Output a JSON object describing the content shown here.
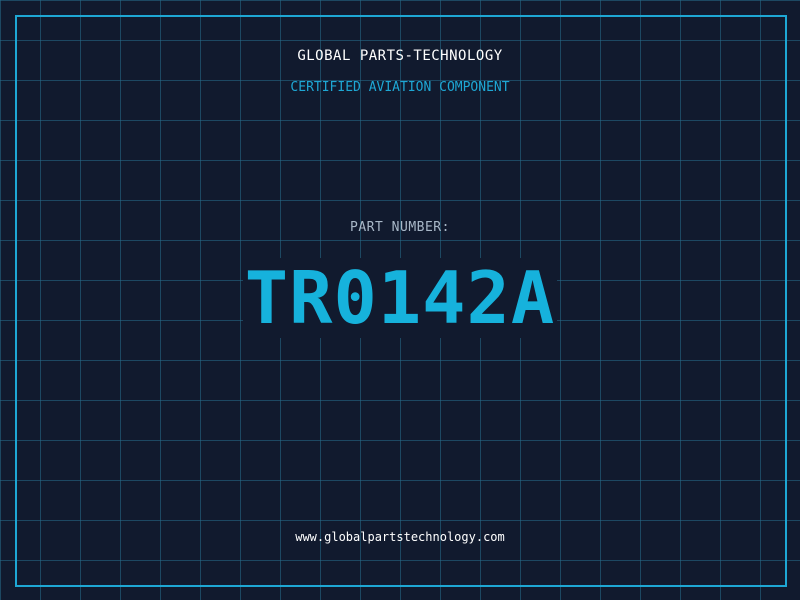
{
  "header": {
    "company": "GLOBAL PARTS-TECHNOLOGY",
    "subtitle": "CERTIFIED AVIATION COMPONENT"
  },
  "main": {
    "label": "PART NUMBER:",
    "part_number": "TR0142A"
  },
  "footer": {
    "website": "www.globalpartstechnology.com"
  },
  "colors": {
    "background": "#111a2e",
    "accent": "#1ea7d4",
    "part_number": "#16b2dc",
    "label": "#a9b8c8",
    "text": "#ffffff"
  }
}
